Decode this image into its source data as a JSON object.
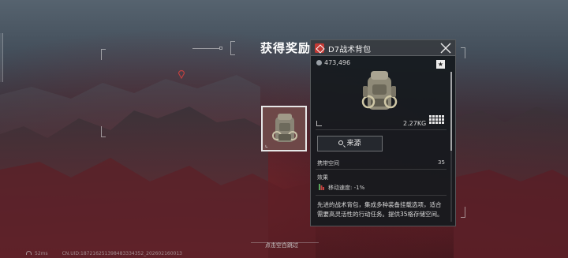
{
  "reward": {
    "title": "获得奖励",
    "slot_item_icon": "backpack-icon"
  },
  "item_panel": {
    "name": "D7战术背包",
    "rarity_color": "#c23a35",
    "price": "473,496",
    "weight": "2.27KG",
    "source_button_label": "来源",
    "capacity_label": "携带空间",
    "capacity_value": "35",
    "effect_label": "效果",
    "effect_text": "移动速度: -1%",
    "description": "先进的战术背包，集成多种装备挂载选项，适合需要高灵活性的行动任务。提供35格存储空间。",
    "favorite_icon": "star-icon",
    "close_icon": "close-icon"
  },
  "hint": {
    "tap_blank_close": "点击空白跳过"
  },
  "footer": {
    "ping": "52ms",
    "uid": "CN.UID:187216251398483334352_202602160013"
  }
}
